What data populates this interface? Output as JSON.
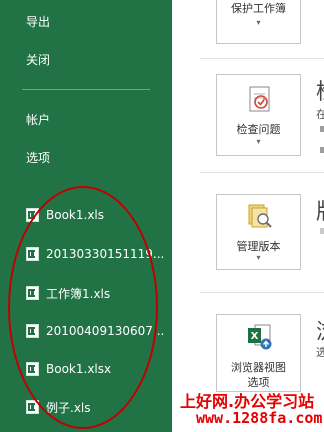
{
  "sidebar": {
    "background": "#217346",
    "menu": [
      {
        "label": "导出"
      },
      {
        "label": "关闭"
      },
      {
        "label": "帐户"
      },
      {
        "label": "选项"
      }
    ],
    "recent_files": [
      {
        "label": "Book1.xls",
        "icon": "excel-file-icon"
      },
      {
        "label": "20130330151119...",
        "icon": "excel-file-icon"
      },
      {
        "label": "工作簿1.xls",
        "icon": "excel-file-icon"
      },
      {
        "label": "20100409130607...",
        "icon": "excel-file-icon"
      },
      {
        "label": "Book1.xlsx",
        "icon": "excel-file-icon"
      },
      {
        "label": "例子.xls",
        "icon": "excel-file-icon"
      }
    ]
  },
  "main": {
    "protect_card": {
      "label": "保护工作簿",
      "icon": "lock-icon"
    },
    "inspect": {
      "heading": "检",
      "sub": "在",
      "card_label": "检查问题",
      "icon": "inspect-document-icon"
    },
    "versions": {
      "heading": "版",
      "card_label": "管理版本",
      "icon": "manage-versions-icon"
    },
    "browser": {
      "heading": "浏",
      "sub": "选",
      "card_label_1": "浏览器视图",
      "card_label_2": "选项",
      "icon": "browser-view-icon"
    }
  },
  "watermark": {
    "line1": "上好网.办公学习站",
    "line2": "www.1288fa.com",
    "color": "#e60000"
  },
  "annotation": {
    "color": "#c00000"
  }
}
